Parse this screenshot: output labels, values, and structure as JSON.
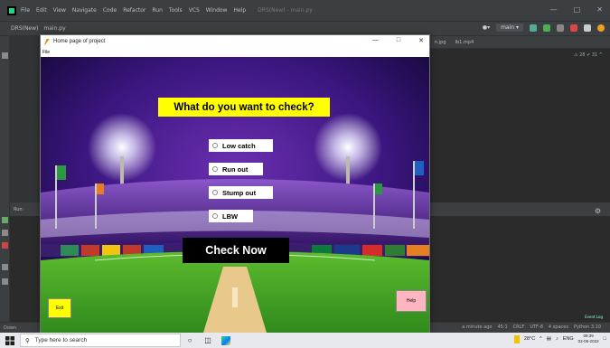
{
  "ide": {
    "menu": [
      "File",
      "Edit",
      "View",
      "Navigate",
      "Code",
      "Refactor",
      "Run",
      "Tools",
      "VCS",
      "Window",
      "Help"
    ],
    "window_title": "DRS(New) - main.py",
    "nav": {
      "project": "DRS(New)",
      "file": "main.py"
    },
    "branch": "main",
    "editor_tabs": [
      "n.jpg",
      "Ib1.mp4"
    ],
    "warnings": "⚠ 28  ✔ 31  ^",
    "status_left": "Down",
    "status_right": [
      "a minute ago",
      "45:1",
      "CRLF",
      "UTF-8",
      "4 spaces",
      "Python 3.10"
    ],
    "event_log": "Event Log",
    "run_label": "Run:"
  },
  "app": {
    "window_title": "Home page of project",
    "menu_file": "File",
    "question": "What do you want to check?",
    "options": [
      "Low catch",
      "Run out",
      "Stump out",
      "LBW"
    ],
    "check_now": "Check Now",
    "exit": "Exit",
    "help": "Help"
  },
  "taskbar": {
    "search_placeholder": "Type here to search",
    "weather": "28°C",
    "lang": "ENG",
    "time": "09:39",
    "date": "02-05-2022"
  },
  "colors": {
    "question_bg": "#ffff00",
    "exit_bg": "#ffff00",
    "help_bg": "#ffb6c1",
    "check_now_bg": "#000000"
  }
}
